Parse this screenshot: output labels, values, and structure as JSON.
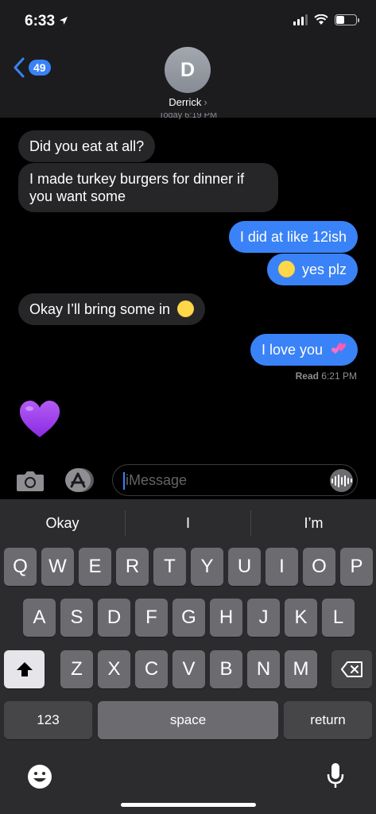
{
  "status_bar": {
    "time": "6:33"
  },
  "nav": {
    "back_count": "49",
    "avatar_initial": "D",
    "contact_name": "Derrick",
    "timestamp": "Today 6:19 PM"
  },
  "messages": [
    {
      "direction": "incoming",
      "text": "Did you eat at all?"
    },
    {
      "direction": "incoming",
      "text": "I made turkey burgers for dinner if you want some"
    },
    {
      "direction": "outgoing",
      "text": "I did at like 12ish"
    },
    {
      "direction": "outgoing",
      "text": "yes plz",
      "emoji": "pleading-face"
    },
    {
      "direction": "incoming",
      "text": "Okay I’ll bring some in",
      "emoji": "smiling-face"
    },
    {
      "direction": "outgoing",
      "text": "I love you",
      "emoji": "two-hearts"
    },
    {
      "direction": "outgoing",
      "emoji": "purple-heart"
    }
  ],
  "read_receipt": {
    "label": "Read",
    "time": "6:21 PM"
  },
  "composer": {
    "placeholder": "iMessage"
  },
  "predictions": [
    "Okay",
    "I",
    "I’m"
  ],
  "keyboard": {
    "row1": [
      "Q",
      "W",
      "E",
      "R",
      "T",
      "Y",
      "U",
      "I",
      "O",
      "P"
    ],
    "row2": [
      "A",
      "S",
      "D",
      "F",
      "G",
      "H",
      "J",
      "K",
      "L"
    ],
    "row3": [
      "Z",
      "X",
      "C",
      "V",
      "B",
      "N",
      "M"
    ],
    "numbers_label": "123",
    "space_label": "space",
    "return_label": "return"
  },
  "colors": {
    "accent": "#3a82f7",
    "incoming_bubble": "#262628",
    "background": "#000000"
  }
}
